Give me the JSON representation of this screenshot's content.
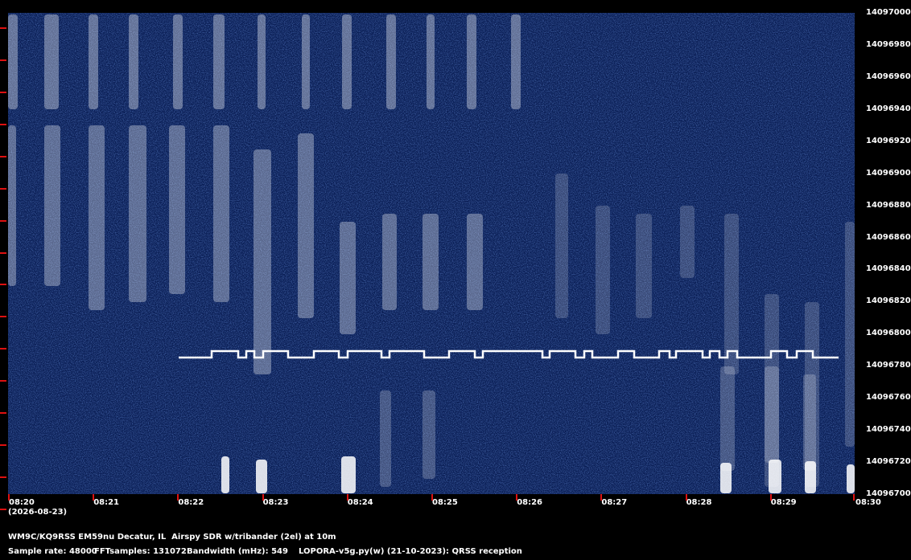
{
  "chart_data": {
    "type": "heatmap",
    "title": "",
    "y_ticks": [
      "14097000",
      "14096980",
      "14096960",
      "14096940",
      "14096920",
      "14096900",
      "14096880",
      "14096860",
      "14096840",
      "14096820",
      "14096800",
      "14096780",
      "14096760",
      "14096740",
      "14096720",
      "14096700"
    ],
    "x_ticks": [
      "08:20",
      "08:21",
      "08:22",
      "08:23",
      "08:24",
      "08:25",
      "08:26",
      "08:27",
      "08:28",
      "08:29",
      "08:30"
    ],
    "ylim": [
      14096700,
      14097000
    ],
    "date": "(2026-08-23)",
    "background_color": "#0a1e55",
    "signal_color": "#ffffff",
    "tick_color": "#dd1010"
  },
  "footer": {
    "station": "WM9C/KQ9RSS EM59nu Decatur, IL  Airspy SDR w/tribander (2el) at 10m",
    "sample_rate": "Sample rate: 48000",
    "fft": "FFTsamples: 131072",
    "bandwidth": "Bandwidth (mHz): 549",
    "software": "LOPORA-v5g.py(w) (21-10-2023): QRSS reception"
  }
}
